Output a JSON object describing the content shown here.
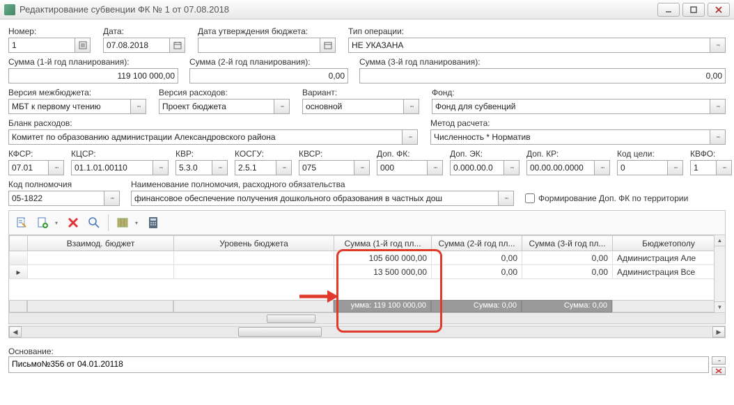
{
  "window": {
    "title": "Редактирование субвенции ФК № 1 от 07.08.2018"
  },
  "labels": {
    "number": "Номер:",
    "date": "Дата:",
    "budget_approve_date": "Дата утверждения бюджета:",
    "op_type": "Тип операции:",
    "sum1": "Сумма (1-й год планирования):",
    "sum2": "Сумма (2-й год планирования):",
    "sum3": "Сумма (3-й год планирования):",
    "interbudget_ver": "Версия межбюджета:",
    "expense_ver": "Версия расходов:",
    "variant": "Вариант:",
    "fund": "Фонд:",
    "expense_blank": "Бланк расходов:",
    "calc_method": "Метод расчета:",
    "kfsr": "КФСР:",
    "kcsr": "КЦСР:",
    "kvr": "КВР:",
    "kosgu": "КОСГУ:",
    "kvsr": "КВСР:",
    "dopfk": "Доп. ФК:",
    "dopek": "Доп. ЭК:",
    "dopkr": "Доп. КР:",
    "goalcode": "Код цели:",
    "kvfo": "КВФО:",
    "authcode": "Код полномочия",
    "authname": "Наименование полномочия, расходного обязательства",
    "form_dopfk": "Формирование Доп. ФК по территории",
    "basis": "Основание:"
  },
  "values": {
    "number": "1",
    "date": "07.08.2018",
    "budget_approve_date": "",
    "op_type": "НЕ УКАЗАНА",
    "sum1": "119 100 000,00",
    "sum2": "0,00",
    "sum3": "0,00",
    "interbudget_ver": "МБТ к первому чтению",
    "expense_ver": "Проект бюджета",
    "variant": "основной",
    "fund": "Фонд для субвенций",
    "expense_blank": "Комитет по образованию администрации Александровского района",
    "calc_method": "Численность * Норматив",
    "kfsr": "07.01",
    "kcsr": "01.1.01.00110",
    "kvr": "5.3.0",
    "kosgu": "2.5.1",
    "kvsr": "075",
    "dopfk": "000",
    "dopek": "0.000.00.0",
    "dopkr": "00.00.00.0000",
    "goalcode": "0",
    "kvfo": "1",
    "authcode": "05-1822",
    "authname": "финансовое обеспечение получения дошкольного образования в частных дош",
    "form_dopfk_checked": false,
    "basis": "Письмо№356 от 04.01.20118"
  },
  "table": {
    "headers": {
      "rowhdr": "",
      "interbudget": "Взаимод. бюджет",
      "budget_level": "Уровень бюджета",
      "sum_y1": "Сумма (1-й год пл...",
      "sum_y2": "Сумма (2-й год пл...",
      "sum_y3": "Сумма (3-й год пл...",
      "recipient": "Бюджетополу"
    },
    "rows": [
      {
        "interbudget": "",
        "budget_level": "",
        "sum_y1": "105 600 000,00",
        "sum_y2": "0,00",
        "sum_y3": "0,00",
        "recipient": "Администрация Але"
      },
      {
        "interbudget": "",
        "budget_level": "",
        "sum_y1": "13 500 000,00",
        "sum_y2": "0,00",
        "sum_y3": "0,00",
        "recipient": "Администрация Все"
      }
    ],
    "summary": {
      "sum_y1": "умма: 119 100 000,00",
      "sum_y2": "Сумма: 0,00",
      "sum_y3": "Сумма: 0,00"
    }
  }
}
